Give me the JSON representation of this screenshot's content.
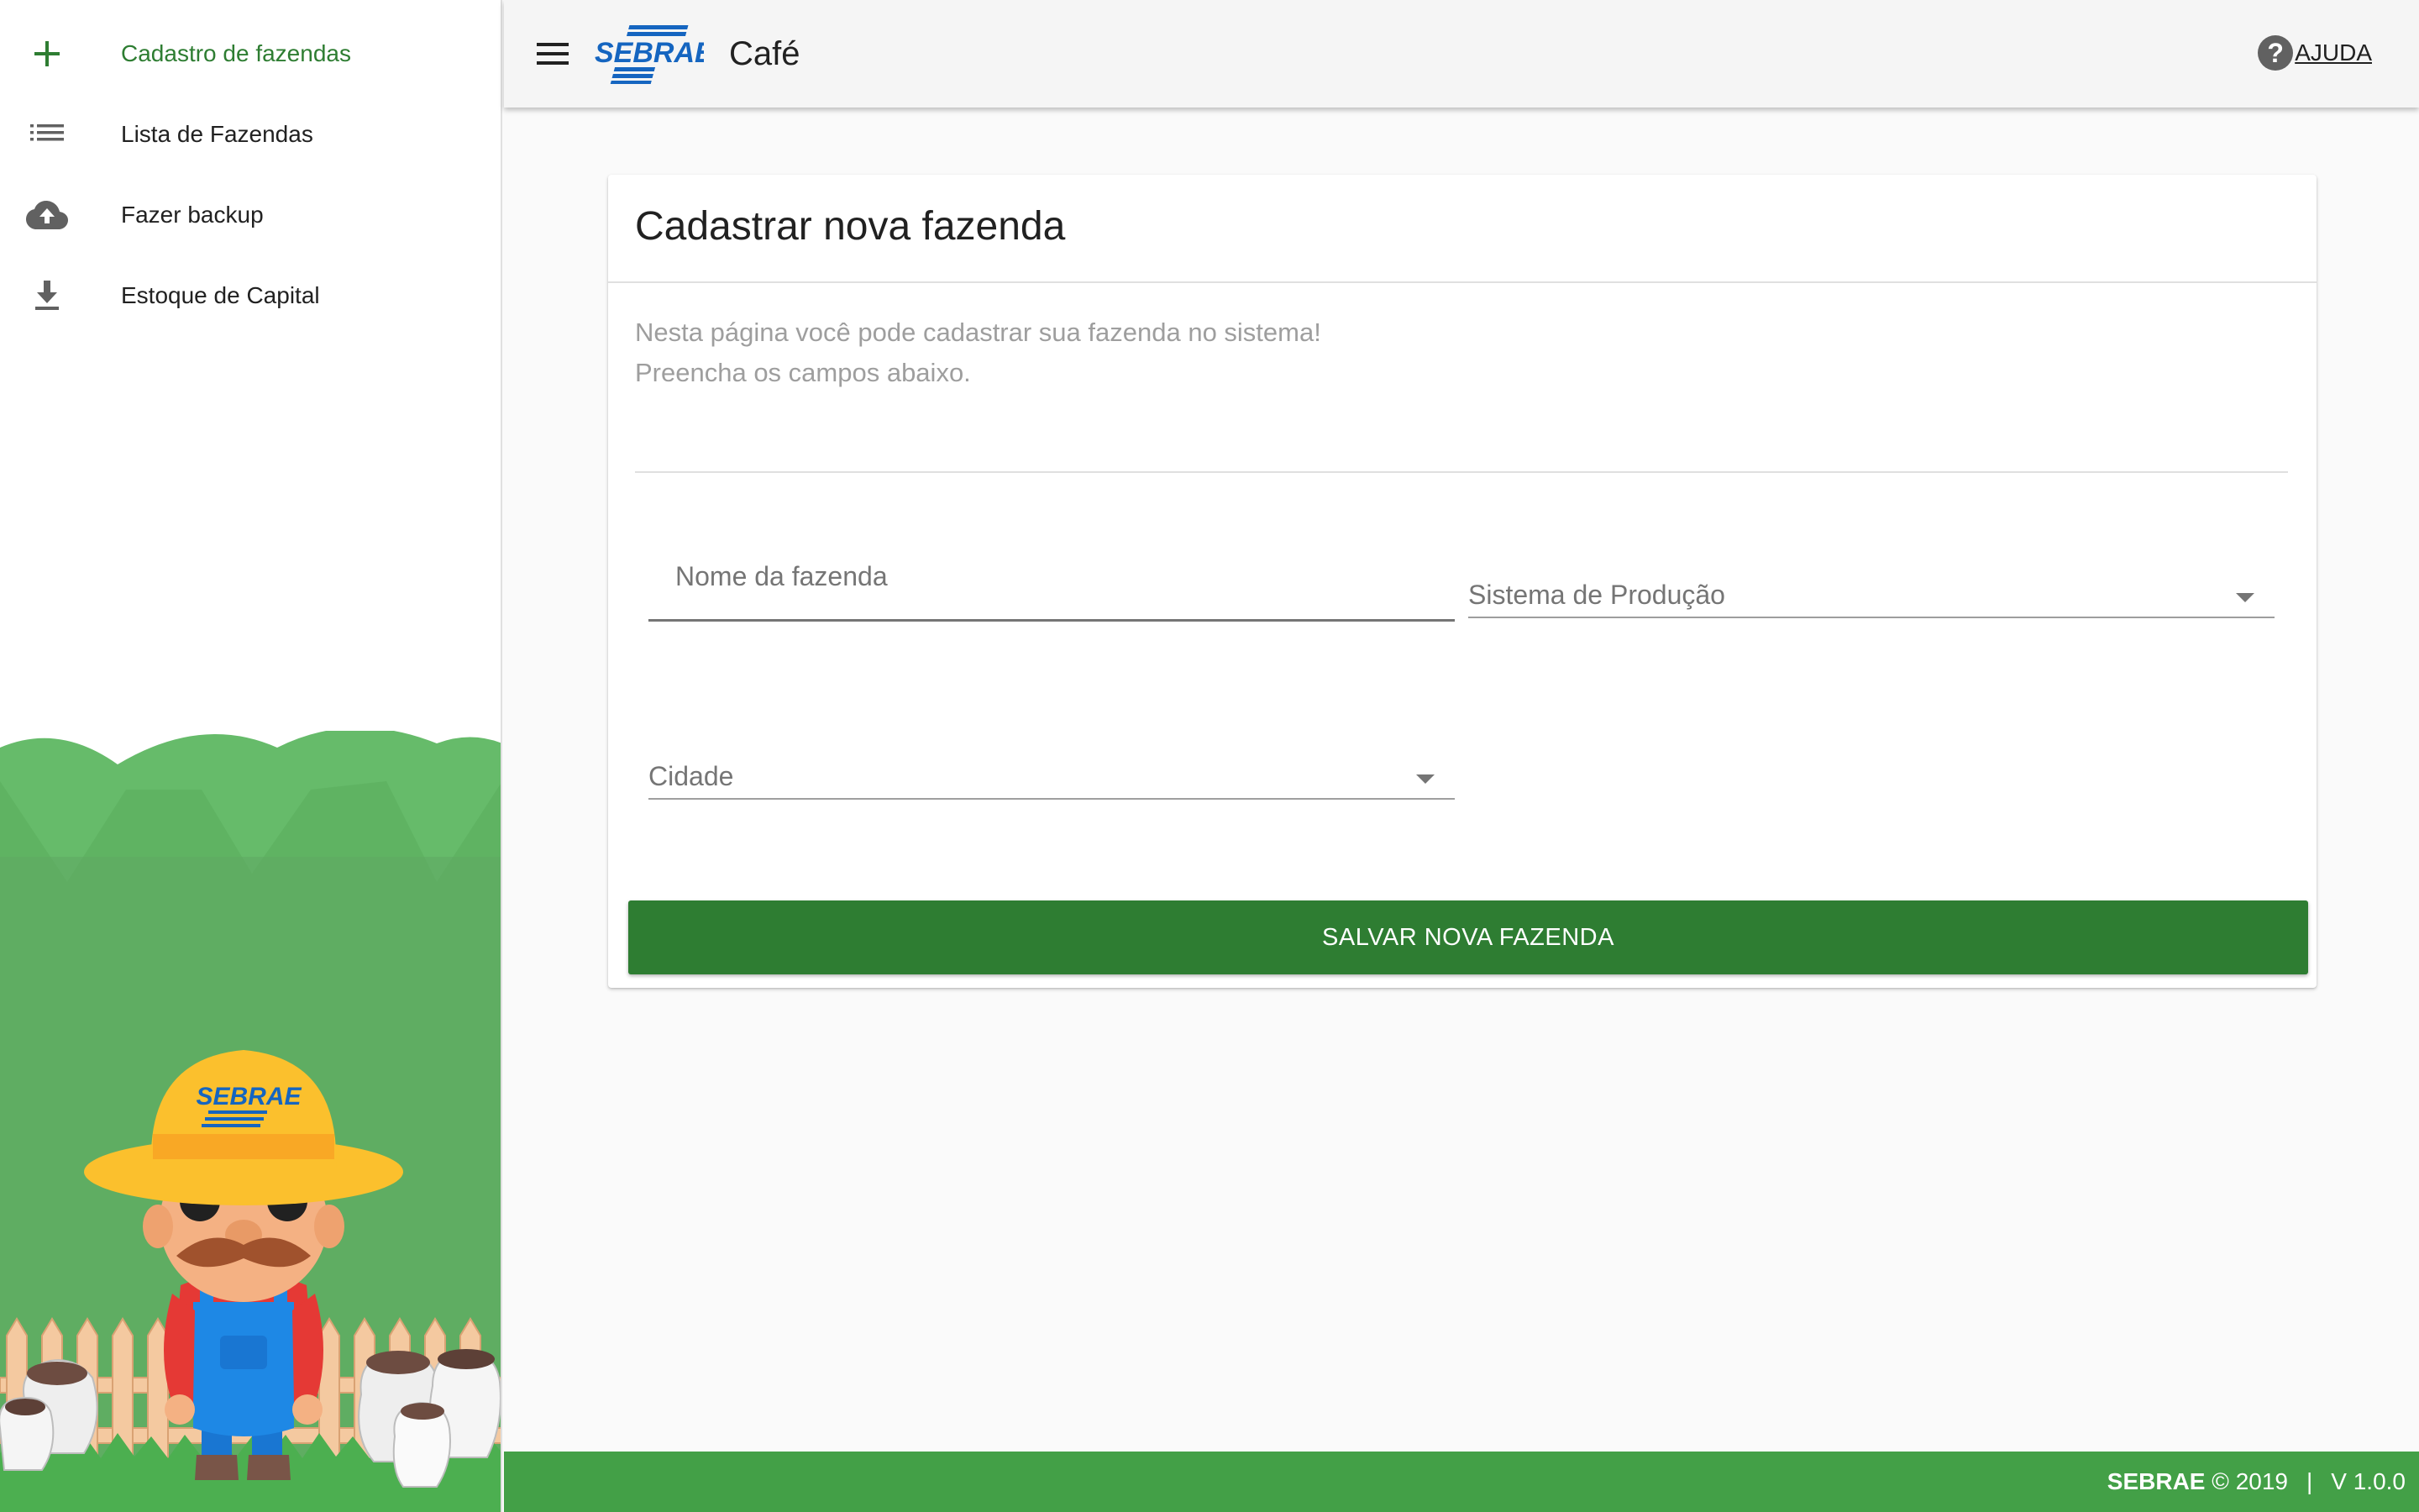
{
  "sidebar": {
    "items": [
      {
        "label": "Cadastro de fazendas",
        "icon": "plus-icon",
        "active": true
      },
      {
        "label": "Lista de Fazendas",
        "icon": "list-icon",
        "active": false
      },
      {
        "label": "Fazer backup",
        "icon": "cloud-upload-icon",
        "active": false
      },
      {
        "label": "Estoque de Capital",
        "icon": "download-icon",
        "active": false
      }
    ],
    "mascot_hat_text": "SEBRAE"
  },
  "header": {
    "logo_text": "SEBRAE",
    "title": "Café",
    "help_icon": "?",
    "help_label": "AJUDA"
  },
  "card": {
    "title": "Cadastrar nova fazenda",
    "description_line1": "Nesta página você pode cadastrar sua fazenda no sistema!",
    "description_line2": "Preencha os campos abaixo.",
    "fields": {
      "farm_name": {
        "placeholder": "Nome da fazenda",
        "value": ""
      },
      "production_system": {
        "label": "Sistema de Produção",
        "value": ""
      },
      "city": {
        "label": "Cidade",
        "value": ""
      }
    },
    "save_label": "SALVAR NOVA FAZENDA"
  },
  "footer": {
    "brand": "SEBRAE",
    "copyright": "© 2019",
    "separator": "|",
    "version": "V 1.0.0"
  },
  "colors": {
    "accent_green": "#2e7d32",
    "footer_green": "#43a047",
    "sebrae_blue": "#1565c0",
    "scene_green": "#66bb6a"
  }
}
